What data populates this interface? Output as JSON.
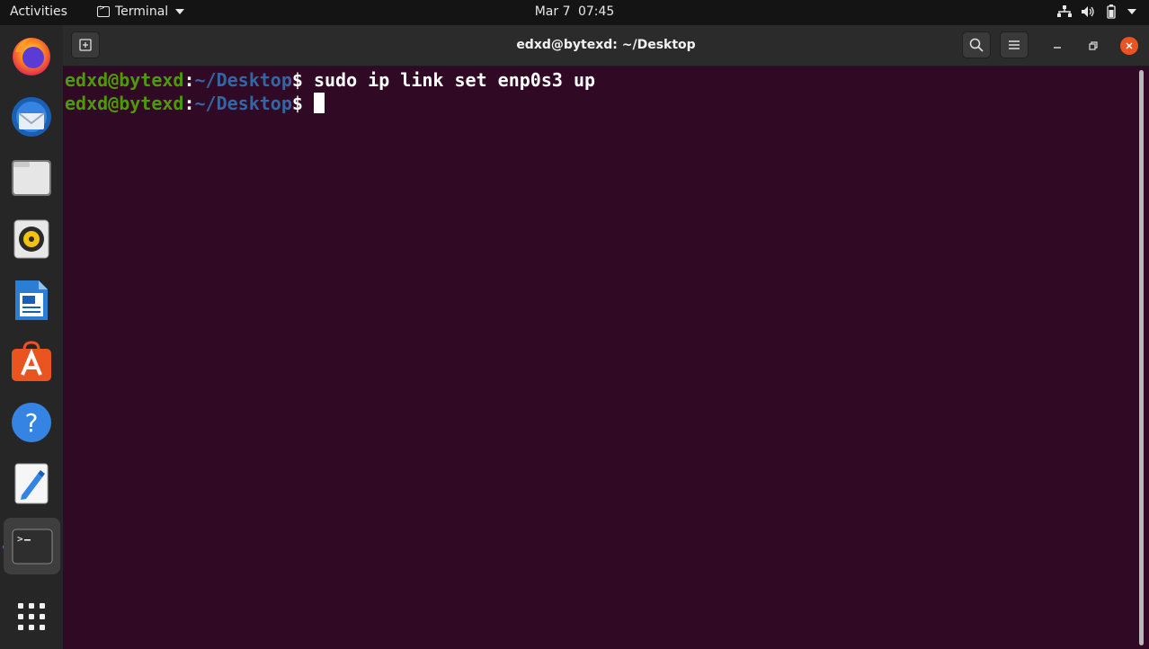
{
  "topbar": {
    "activities": "Activities",
    "app_name": "Terminal",
    "date": "Mar 7",
    "time": "07:45",
    "status_icons": [
      "network-icon",
      "volume-icon",
      "battery-icon",
      "power-icon"
    ]
  },
  "dock": {
    "items": [
      {
        "name": "firefox",
        "icon": "firefox-icon"
      },
      {
        "name": "thunderbird",
        "icon": "thunderbird-icon"
      },
      {
        "name": "files",
        "icon": "files-icon"
      },
      {
        "name": "rhythmbox",
        "icon": "rhythmbox-icon"
      },
      {
        "name": "libreoffice-writer",
        "icon": "writer-icon"
      },
      {
        "name": "software",
        "icon": "software-icon"
      },
      {
        "name": "help",
        "icon": "help-icon"
      },
      {
        "name": "text-editor",
        "icon": "text-editor-icon"
      },
      {
        "name": "terminal",
        "icon": "terminal-icon",
        "active": true
      },
      {
        "name": "show-apps",
        "icon": "app-grid-icon"
      }
    ],
    "accent": "#e95420"
  },
  "window": {
    "title": "edxd@bytexd: ~/Desktop",
    "background": "#300a24"
  },
  "terminal": {
    "lines": [
      {
        "user": "edxd@bytexd",
        "sep": ":",
        "path": "~/Desktop",
        "prompt": "$ ",
        "command": "sudo ip link set enp0s3 up"
      },
      {
        "user": "edxd@bytexd",
        "sep": ":",
        "path": "~/Desktop",
        "prompt": "$ ",
        "command": ""
      }
    ],
    "colors": {
      "user": "#4e9a06",
      "path": "#3465a4",
      "text": "#ffffff"
    }
  }
}
